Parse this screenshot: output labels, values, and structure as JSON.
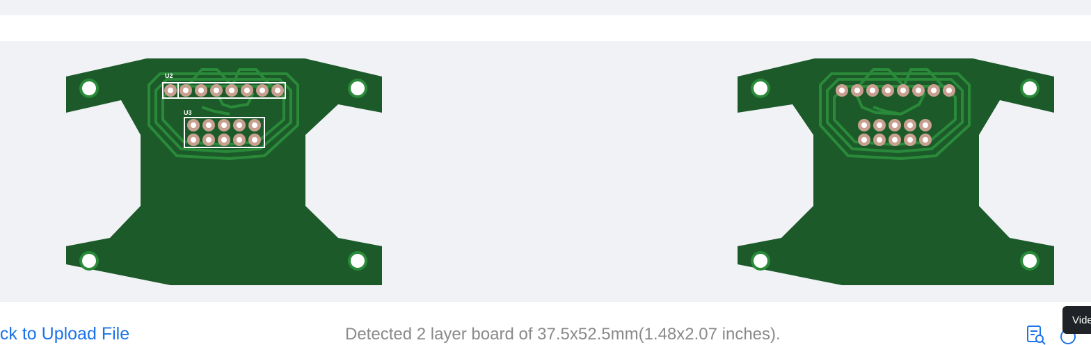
{
  "viewer": {
    "top_layer": {
      "labels": {
        "u2": "U2",
        "u3": "U3"
      }
    },
    "bottom_layer": {}
  },
  "footer": {
    "back_link": "ack to Upload File",
    "detection_text": "Detected 2 layer board of 37.5x52.5mm(1.48x2.07 inches).",
    "zoom_icon": "zoom-in-document-icon",
    "tooltip_text": "Vide"
  },
  "colors": {
    "board": "#1c5a2a",
    "trace": "#2a8a3a",
    "pad": "#c8a090",
    "link": "#1a73e8",
    "background": "#f1f2f6"
  }
}
